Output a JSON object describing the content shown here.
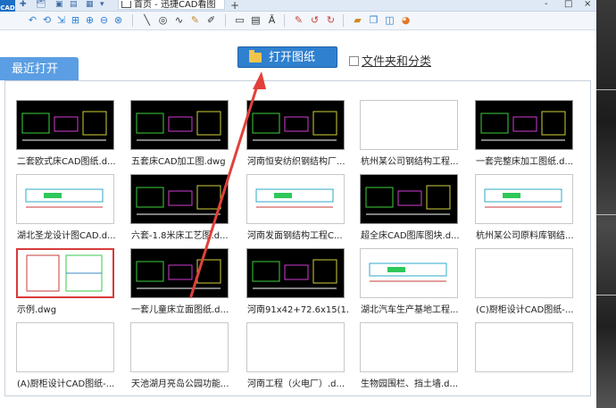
{
  "app": {
    "logo_text": "CAD",
    "tab_title": "首页 - 迅捷CAD看图",
    "new_tab": "+",
    "window_buttons": [
      "-",
      "□",
      "×"
    ]
  },
  "toolbar": {
    "icons": [
      "back-icon",
      "forward-icon",
      "open-icon",
      "save-icon",
      "print-icon",
      "undo-icon",
      "zoom-window-icon",
      "zoom-in-icon",
      "zoom-out-icon",
      "zoom-extent-icon",
      "line-icon",
      "circle-icon",
      "polyline-icon",
      "pencil-icon",
      "erase-icon",
      "frame-icon",
      "layer-icon",
      "text-icon",
      "markup-icon",
      "rotate-left-icon",
      "rotate-right-icon",
      "export-icon",
      "copy-icon",
      "color-icon"
    ]
  },
  "main": {
    "open_button_label": "打开图纸",
    "folder_classify_label": "文件夹和分类",
    "recent_tab_label": "最近打开"
  },
  "files": [
    {
      "name": "二套欧式床CAD图纸.d...",
      "thumb": "dark"
    },
    {
      "name": "五套床CAD加工图.dwg",
      "thumb": "dark"
    },
    {
      "name": "河南恒安纺织钢结构厂...",
      "thumb": "dark"
    },
    {
      "name": "杭州某公司钢结构工程...",
      "thumb": "blank"
    },
    {
      "name": "一套完整床加工图纸.d...",
      "thumb": "dark"
    },
    {
      "name": "湖北圣龙设计图CAD.d...",
      "thumb": "light"
    },
    {
      "name": "六套-1.8米床工艺图.d...",
      "thumb": "dark"
    },
    {
      "name": "河南发面钢结构工程C...",
      "thumb": "light"
    },
    {
      "name": "超全床CAD图库图块.d...",
      "thumb": "dark"
    },
    {
      "name": "杭州某公司原料库钢结...",
      "thumb": "light"
    },
    {
      "name": "示例.dwg",
      "thumb": "sample"
    },
    {
      "name": "一套儿童床立面图纸.d...",
      "thumb": "dark"
    },
    {
      "name": "河南91x42+72.6x15(1...",
      "thumb": "dark"
    },
    {
      "name": "湖北汽车生产基地工程...",
      "thumb": "light"
    },
    {
      "name": "(C)厨柜设计CAD图纸-...",
      "thumb": "blank"
    },
    {
      "name": "(A)厨柜设计CAD图纸-...",
      "thumb": "blank"
    },
    {
      "name": "天池湖月亮岛公园功能...",
      "thumb": "blank"
    },
    {
      "name": "河南工程（火电厂）.d...",
      "thumb": "blank"
    },
    {
      "name": "生物园围栏、挡土墙.d...",
      "thumb": "blank"
    },
    {
      "name": "",
      "thumb": "blank"
    }
  ],
  "colors": {
    "accent": "#2f80cf",
    "tab": "#5b9ee3",
    "annotation_arrow": "#e0413a"
  }
}
